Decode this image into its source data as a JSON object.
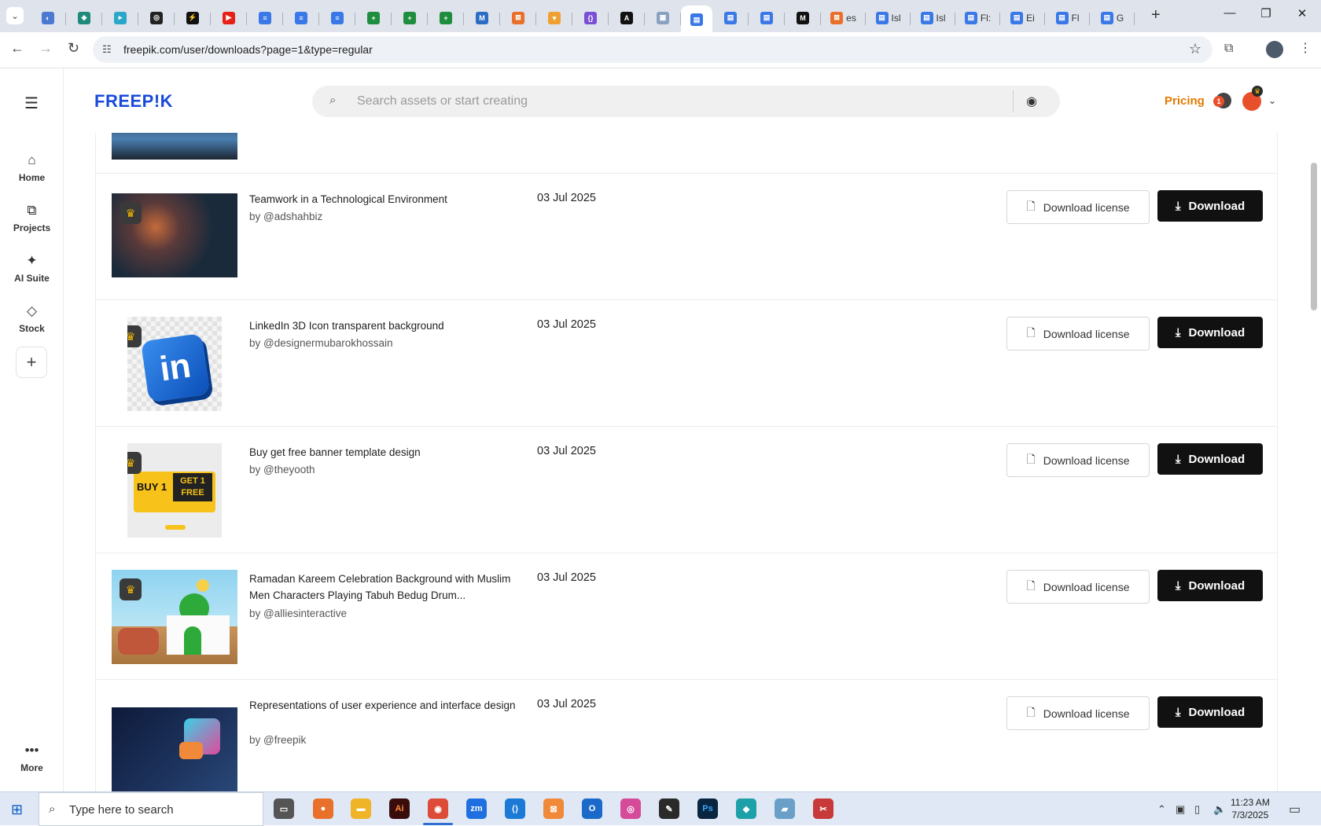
{
  "browser": {
    "tabs": [
      {
        "name": "tab-1",
        "color": "#4a7bd0",
        "glyph": "◐",
        "label": ""
      },
      {
        "name": "tab-2",
        "color": "#1f8a7a",
        "glyph": "◈",
        "label": ""
      },
      {
        "name": "tab-3",
        "color": "#2aa7c9",
        "glyph": "▸",
        "label": ""
      },
      {
        "name": "tab-4",
        "color": "#222222",
        "glyph": "◎",
        "label": ""
      },
      {
        "name": "tab-5",
        "color": "#111111",
        "glyph": "⚡",
        "label": ""
      },
      {
        "name": "tab-6",
        "color": "#e62117",
        "glyph": "▶",
        "label": ""
      },
      {
        "name": "tab-7",
        "color": "#3b78e7",
        "glyph": "≡",
        "label": ""
      },
      {
        "name": "tab-8",
        "color": "#3b78e7",
        "glyph": "≡",
        "label": ""
      },
      {
        "name": "tab-9",
        "color": "#3b78e7",
        "glyph": "≡",
        "label": ""
      },
      {
        "name": "tab-10",
        "color": "#1e8e3e",
        "glyph": "+",
        "label": ""
      },
      {
        "name": "tab-11",
        "color": "#1e8e3e",
        "glyph": "+",
        "label": ""
      },
      {
        "name": "tab-12",
        "color": "#1e8e3e",
        "glyph": "+",
        "label": ""
      },
      {
        "name": "tab-13",
        "color": "#2b6cc4",
        "glyph": "M",
        "label": ""
      },
      {
        "name": "tab-14",
        "color": "#e8702a",
        "glyph": "⊠",
        "label": ""
      },
      {
        "name": "tab-15",
        "color": "#f0a030",
        "glyph": "♥",
        "label": ""
      },
      {
        "name": "tab-16",
        "color": "#7a4fd6",
        "glyph": "{}",
        "label": ""
      },
      {
        "name": "tab-17",
        "color": "#111111",
        "glyph": "A",
        "label": ""
      },
      {
        "name": "tab-18",
        "color": "#8aa0c0",
        "glyph": "▦",
        "label": ""
      },
      {
        "name": "tab-19",
        "color": "#3b78e7",
        "glyph": "▤",
        "label": "",
        "active": true
      },
      {
        "name": "tab-20",
        "color": "#3b78e7",
        "glyph": "▤",
        "label": ""
      },
      {
        "name": "tab-21",
        "color": "#3b78e7",
        "glyph": "▤",
        "label": ""
      },
      {
        "name": "tab-22",
        "color": "#111111",
        "glyph": "M",
        "label": ""
      },
      {
        "name": "tab-23",
        "color": "#e8702a",
        "glyph": "⊠",
        "label": "es"
      },
      {
        "name": "tab-24",
        "color": "#3b78e7",
        "glyph": "▤",
        "label": "Isl"
      },
      {
        "name": "tab-25",
        "color": "#3b78e7",
        "glyph": "▤",
        "label": "Isl"
      },
      {
        "name": "tab-26",
        "color": "#3b78e7",
        "glyph": "▤",
        "label": "Fl:"
      },
      {
        "name": "tab-27",
        "color": "#3b78e7",
        "glyph": "▤",
        "label": "Ei"
      },
      {
        "name": "tab-28",
        "color": "#3b78e7",
        "glyph": "▤",
        "label": "Fl"
      },
      {
        "name": "tab-29",
        "color": "#3b78e7",
        "glyph": "▤",
        "label": "G"
      }
    ],
    "url": "freepik.com/user/downloads?page=1&type=regular"
  },
  "header": {
    "logo": "FREEP!K",
    "search_placeholder": "Search assets or start creating",
    "pricing": "Pricing",
    "notification_count": "1"
  },
  "rail": {
    "items": [
      {
        "label": "Home",
        "icon": "home-icon"
      },
      {
        "label": "Projects",
        "icon": "projects-icon"
      },
      {
        "label": "AI Suite",
        "icon": "ai-suite-icon"
      },
      {
        "label": "Stock",
        "icon": "stock-icon"
      }
    ],
    "more_label": "More"
  },
  "downloads": [
    {
      "title": "Teamwork in a Technological Environment",
      "author": "by @adshahbiz",
      "date": "03 Jul 2025",
      "premium": true
    },
    {
      "title": "LinkedIn 3D Icon transparent background",
      "author": "by @designermubarokhossain",
      "date": "03 Jul 2025",
      "premium": true
    },
    {
      "title": "Buy get free banner template design",
      "author": "by @theyooth",
      "date": "03 Jul 2025",
      "premium": true
    },
    {
      "title": "Ramadan Kareem Celebration Background with Muslim Men Characters Playing Tabuh Bedug Drum...",
      "author": "by @alliesinteractive",
      "date": "03 Jul 2025",
      "premium": true
    },
    {
      "title": "Representations of user experience and interface design",
      "author": "by @freepik",
      "date": "03 Jul 2025",
      "premium": false
    }
  ],
  "buttons": {
    "license": "Download license",
    "download": "Download"
  },
  "thumbs": {
    "linkedin_text": "in",
    "buy_text_1": "BUY 1",
    "buy_text_2": "GET 1",
    "buy_text_3": "FREE"
  },
  "taskbar": {
    "search_placeholder": "Type here to search",
    "time": "11:23 AM",
    "date": "7/3/2025"
  }
}
